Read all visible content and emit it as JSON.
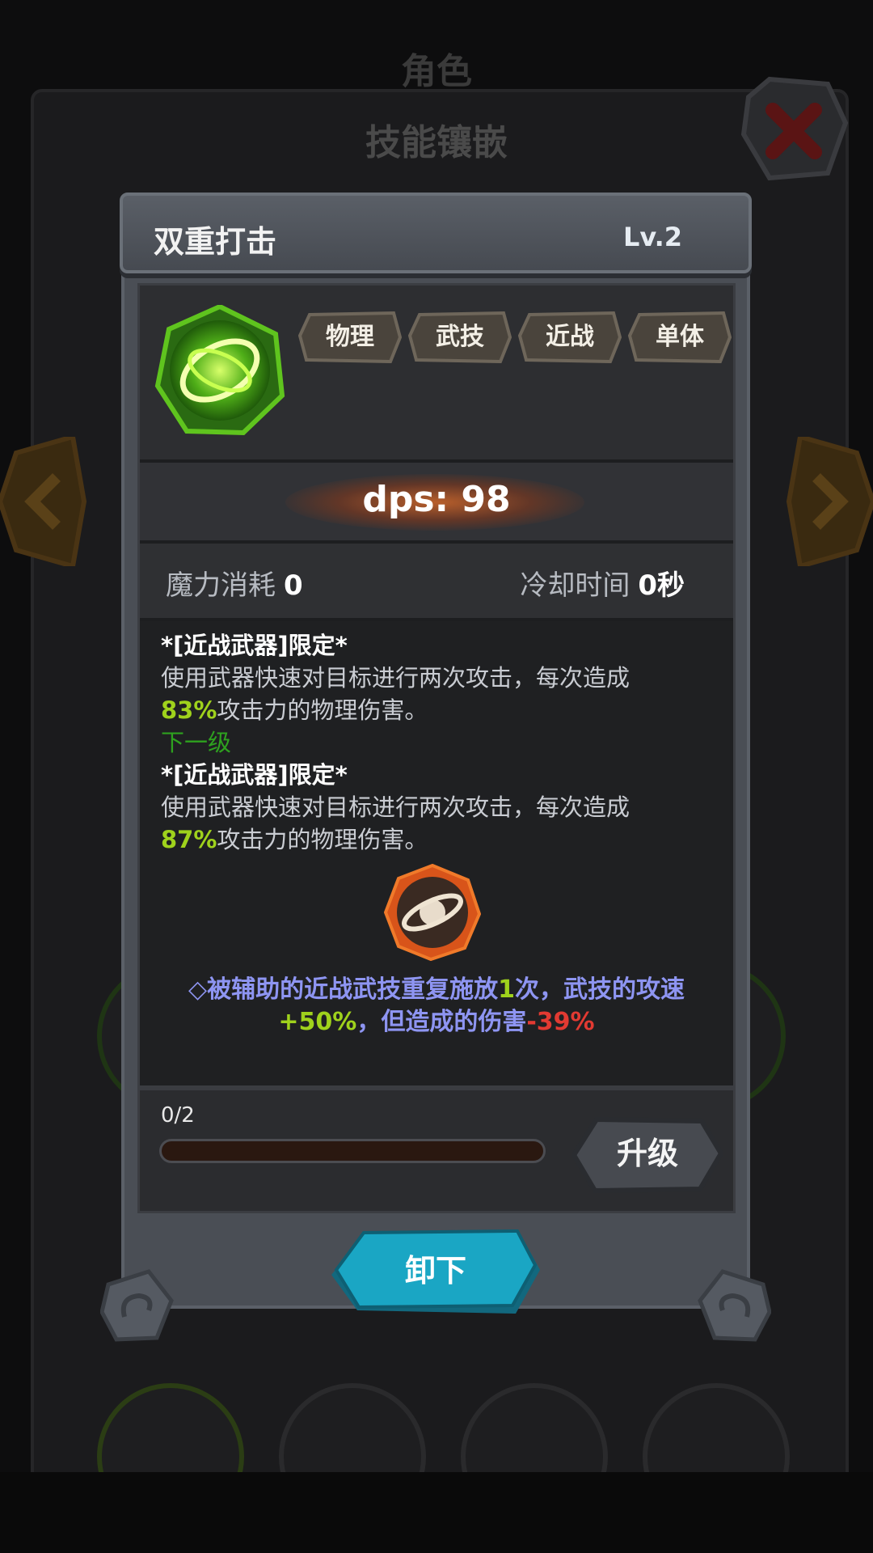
{
  "background": {
    "title": "角色",
    "subtitle": "技能镶嵌",
    "close_icon": "close-x-icon"
  },
  "dialog": {
    "skill_name": "双重打击",
    "level": "Lv.2",
    "skill_icon": "green-swirl-skill-icon",
    "tags": [
      "物理",
      "武技",
      "近战",
      "单体"
    ],
    "dps": "dps: 98",
    "mana_cost_label": "魔力消耗",
    "mana_cost_value": "0",
    "cooldown_label": "冷却时间",
    "cooldown_value": "0秒",
    "description": {
      "current_header": "*[近战武器]限定*",
      "current_text": "使用武器快速对目标进行两次攻击，每次造成",
      "current_percent": "83%",
      "current_suffix": "攻击力的物理伤害。",
      "next_label": "下一级",
      "next_header": "*[近战武器]限定*",
      "next_text": "使用武器快速对目标进行两次攻击，每次造成",
      "next_percent": "87%",
      "next_suffix": "攻击力的物理伤害。"
    },
    "support": {
      "icon": "orbit-ring-support-icon",
      "part1": "◇被辅助的近战武技重复施放",
      "count": "1",
      "part2": "次，武技的攻速",
      "speed_bonus": "+50%",
      "part3": "，但造成的伤害",
      "damage_penalty": "-39%"
    },
    "progress": {
      "label": "0/2",
      "fraction": 0
    },
    "upgrade_label": "升级",
    "unequip_label": "卸下"
  },
  "colors": {
    "accent_green": "#9fd21c",
    "next_level_green": "#2ea11f",
    "support_blue": "#8e95f2",
    "penalty_red": "#e23a32",
    "button_cyan": "#1aa6c4"
  }
}
